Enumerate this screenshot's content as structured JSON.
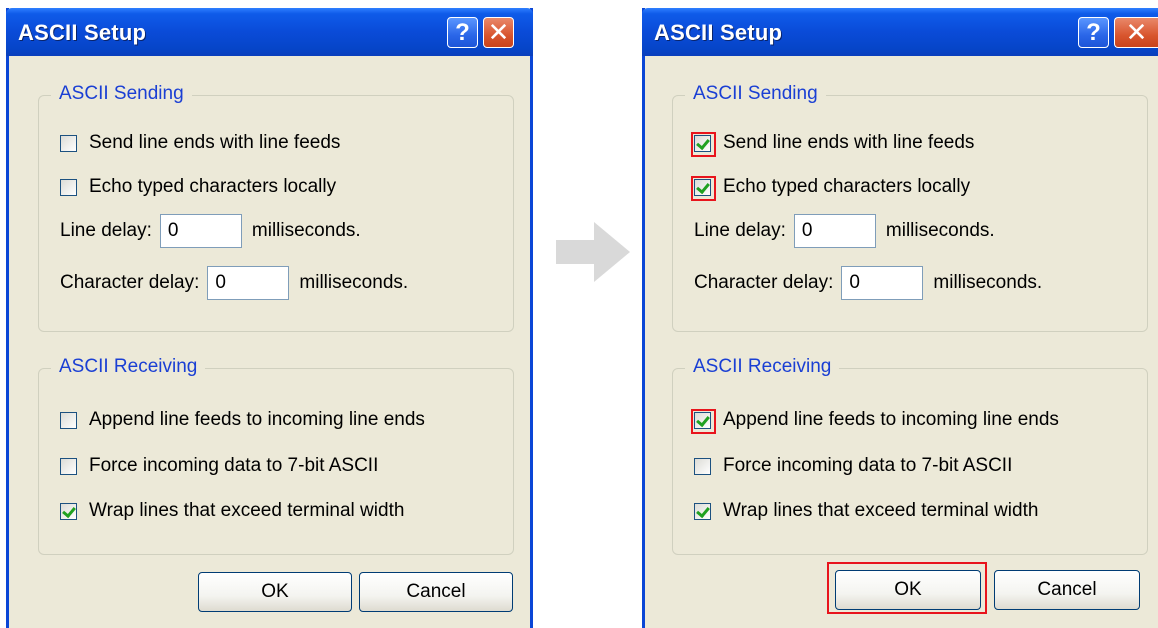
{
  "colors": {
    "titlebar": "#0a4bd8",
    "dialog_bg": "#ece9d8",
    "group_title": "#1a3fd4",
    "check_mark": "#21a121",
    "highlight": "#e8141c",
    "arrow": "#d9d9d9"
  },
  "before": {
    "title": "ASCII Setup",
    "help_icon": "?",
    "close_icon": "✕",
    "sending": {
      "title": "ASCII Sending",
      "send_line_ends": {
        "label": "Send line ends with line feeds",
        "checked": false
      },
      "echo_typed": {
        "label": "Echo typed characters locally",
        "checked": false
      },
      "line_delay": {
        "label": "Line delay:",
        "value": "0",
        "unit": "milliseconds."
      },
      "char_delay": {
        "label": "Character delay:",
        "value": "0",
        "unit": "milliseconds."
      }
    },
    "receiving": {
      "title": "ASCII Receiving",
      "append_line_feeds": {
        "label": "Append line feeds to incoming line ends",
        "checked": false
      },
      "force_7bit": {
        "label": "Force incoming data to 7-bit ASCII",
        "checked": false
      },
      "wrap_lines": {
        "label": "Wrap lines that exceed terminal width",
        "checked": true
      }
    },
    "ok_label": "OK",
    "cancel_label": "Cancel"
  },
  "after": {
    "title": "ASCII Setup",
    "help_icon": "?",
    "close_icon": "✕",
    "sending": {
      "title": "ASCII Sending",
      "send_line_ends": {
        "label": "Send line ends with line feeds",
        "checked": true
      },
      "echo_typed": {
        "label": "Echo typed characters locally",
        "checked": true
      },
      "line_delay": {
        "label": "Line delay:",
        "value": "0",
        "unit": "milliseconds."
      },
      "char_delay": {
        "label": "Character delay:",
        "value": "0",
        "unit": "milliseconds."
      }
    },
    "receiving": {
      "title": "ASCII Receiving",
      "append_line_feeds": {
        "label": "Append line feeds to incoming line ends",
        "checked": true
      },
      "force_7bit": {
        "label": "Force incoming data to 7-bit ASCII",
        "checked": false
      },
      "wrap_lines": {
        "label": "Wrap lines that exceed terminal width",
        "checked": true
      }
    },
    "ok_label": "OK",
    "cancel_label": "Cancel"
  }
}
